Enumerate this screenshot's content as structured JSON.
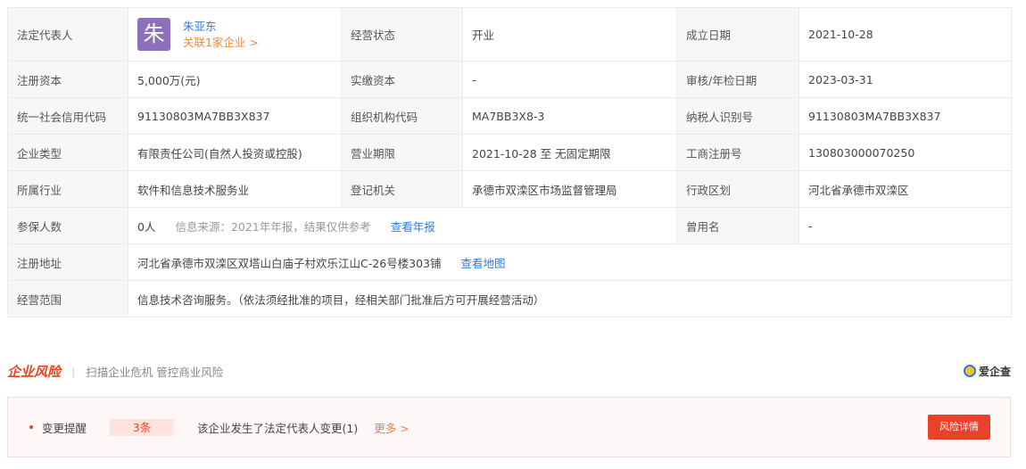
{
  "info": {
    "legal_rep_label": "法定代表人",
    "legal_rep_avatar": "朱",
    "legal_rep_name": "朱亚东",
    "legal_rep_link": "关联1家企业 >",
    "status_label": "经营状态",
    "status": "开业",
    "founded_label": "成立日期",
    "founded": "2021-10-28",
    "reg_capital_label": "注册资本",
    "reg_capital": "5,000万(元)",
    "paid_capital_label": "实缴资本",
    "paid_capital": "-",
    "approval_label": "审核/年检日期",
    "approval": "2023-03-31",
    "credit_code_label": "统一社会信用代码",
    "credit_code": "91130803MA7BB3X837",
    "org_code_label": "组织机构代码",
    "org_code": "MA7BB3X8-3",
    "taxpayer_label": "纳税人识别号",
    "taxpayer": "91130803MA7BB3X837",
    "type_label": "企业类型",
    "type": "有限责任公司(自然人投资或控股)",
    "term_label": "营业期限",
    "term": "2021-10-28 至 无固定期限",
    "biz_reg_label": "工商注册号",
    "biz_reg": "130803000070250",
    "industry_label": "所属行业",
    "industry": "软件和信息技术服务业",
    "authority_label": "登记机关",
    "authority": "承德市双滦区市场监督管理局",
    "district_label": "行政区划",
    "district": "河北省承德市双滦区",
    "insured_label": "参保人数",
    "insured": "0人",
    "insured_source": "信息来源：2021年年报，结果仅供参考",
    "insured_link": "查看年报",
    "former_name_label": "曾用名",
    "former_name": "-",
    "address_label": "注册地址",
    "address": "河北省承德市双滦区双塔山白庙子村欢乐江山C-26号楼303铺",
    "address_link": "查看地图",
    "scope_label": "经营范围",
    "scope": "信息技术咨询服务。（依法须经批准的项目，经相关部门批准后方可开展经营活动）"
  },
  "risk": {
    "title": "企业风险",
    "subtitle": "扫描企业危机 管控商业风险",
    "brand": "爱企查",
    "item_label": "变更提醒",
    "count": "3条",
    "description": "该企业发生了法定代表人变更(1)",
    "more": "更多 >",
    "detail_button": "风险详情"
  }
}
